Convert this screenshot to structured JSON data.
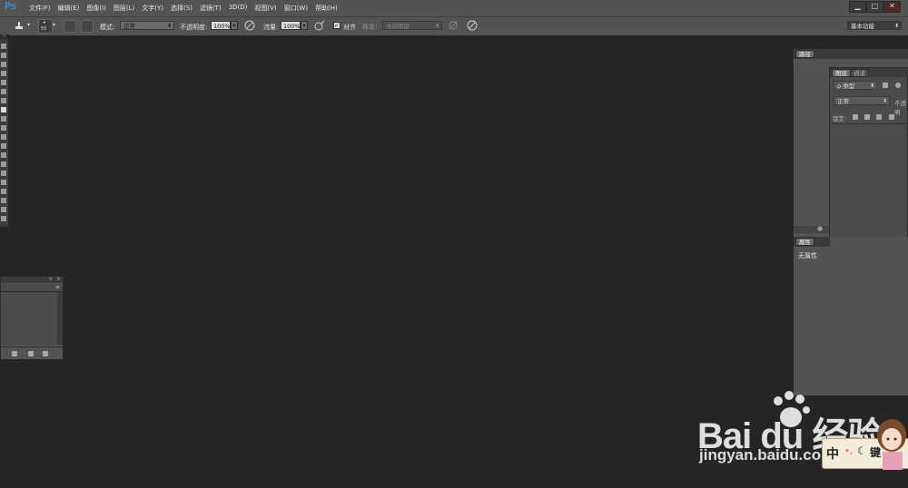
{
  "app": {
    "logo": "Ps"
  },
  "menu": [
    {
      "label": "文件(F)"
    },
    {
      "label": "编辑(E)"
    },
    {
      "label": "图像(I)"
    },
    {
      "label": "图层(L)"
    },
    {
      "label": "文字(Y)"
    },
    {
      "label": "选择(S)"
    },
    {
      "label": "滤镜(T)"
    },
    {
      "label": "3D(D)"
    },
    {
      "label": "视图(V)"
    },
    {
      "label": "窗口(W)"
    },
    {
      "label": "帮助(H)"
    }
  ],
  "window_controls": {
    "minimize": "▁",
    "maximize": "□",
    "close": "✕"
  },
  "options": {
    "brush_size": "55",
    "mode_label": "模式:",
    "mode_value": "正常",
    "opacity_label": "不透明度:",
    "opacity_value": "100%",
    "flow_label": "流量:",
    "flow_value": "100%",
    "align_label": "对齐",
    "align_checked": true,
    "sample_label": "样本:",
    "sample_value": "当前图层",
    "workspace": "基本功能"
  },
  "panels": {
    "paths": {
      "tab": "路径"
    },
    "layers": {
      "tab_layers": "图层",
      "tab_channels": "通道",
      "filter_kind": "ρ 类型",
      "blend_mode": "正常",
      "opacity_label": "不透明",
      "lock_label": "锁定:"
    },
    "properties": {
      "tab": "属性",
      "empty_text": "无属性"
    }
  },
  "watermark": {
    "brand": "Bai du 经验",
    "url": "jingyan.baidu.com"
  },
  "ime": {
    "lang": "中",
    "mode": "键"
  }
}
